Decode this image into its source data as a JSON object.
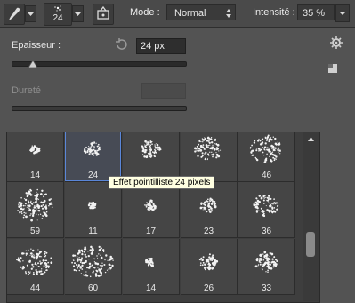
{
  "toolbar": {
    "brush_size": "24",
    "mode_label": "Mode :",
    "mode_value": "Normal",
    "intensity_label": "Intensité :",
    "intensity_value": "35 %"
  },
  "panel": {
    "thickness_label": "Epaisseur :",
    "thickness_value": "24 px",
    "thickness_slider_fraction": 0.12,
    "hardness_label": "Dureté"
  },
  "brushes": [
    {
      "size": "14"
    },
    {
      "size": "24"
    },
    {
      "size": "",
      "hidden_label": true
    },
    {
      "size": "",
      "hidden_label": true
    },
    {
      "size": "46"
    },
    {
      "size": "59"
    },
    {
      "size": "11"
    },
    {
      "size": "17"
    },
    {
      "size": "23"
    },
    {
      "size": "36"
    },
    {
      "size": "44"
    },
    {
      "size": "60"
    },
    {
      "size": "14"
    },
    {
      "size": "26"
    },
    {
      "size": "33"
    }
  ],
  "selected_brush_index": 1,
  "tooltip": "Effet pointilliste 24 pixels",
  "colors": {
    "accent": "#5a86d8",
    "tooltip_bg": "#ffffe1"
  },
  "icons": [
    "brush-preset-icon",
    "chevron-down-icon",
    "airbrush-toggle-icon",
    "reset-icon",
    "gear-icon",
    "new-preset-icon",
    "scroll-up-icon"
  ]
}
